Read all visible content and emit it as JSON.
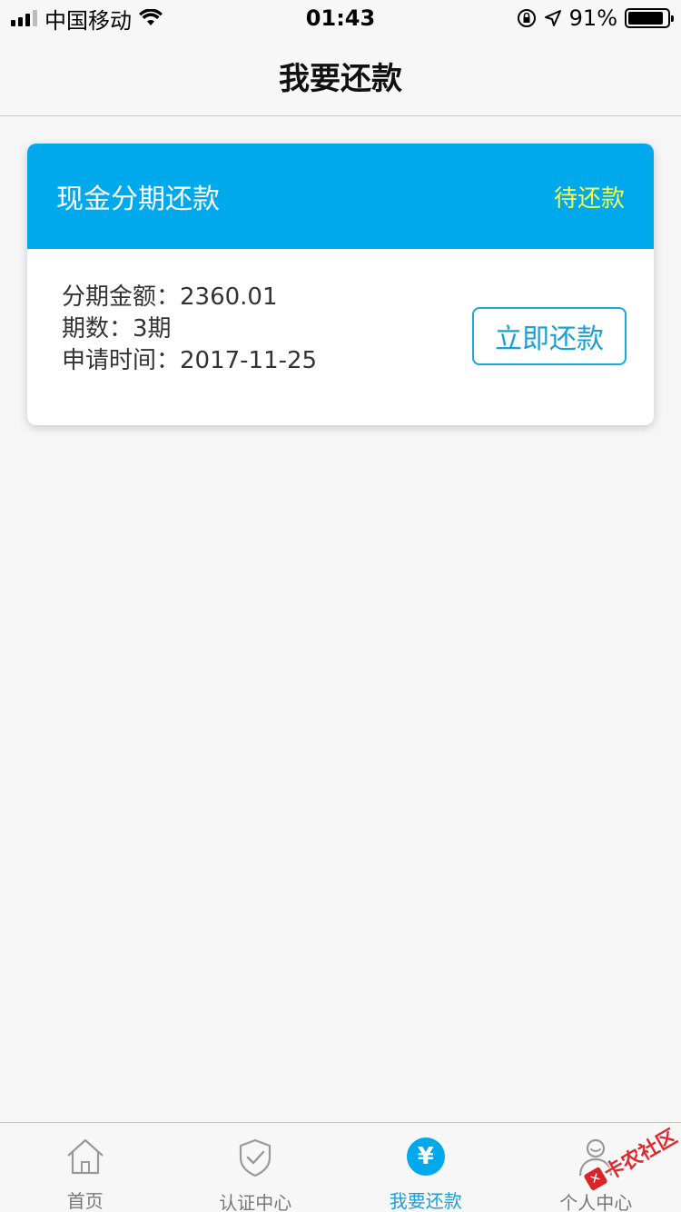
{
  "status_bar": {
    "carrier": "中国移动",
    "time": "01:43",
    "battery_percent": "91%",
    "battery_level": 0.91
  },
  "nav": {
    "title": "我要还款"
  },
  "card": {
    "title": "现金分期还款",
    "status": "待还款",
    "amount_line": "分期金额：2360.01",
    "periods_line": "期数：3期",
    "date_line": "申请时间：2017-11-25",
    "pay_button_label": "立即还款"
  },
  "tabs": [
    {
      "label": "首页",
      "icon": "home-icon"
    },
    {
      "label": "认证中心",
      "icon": "shield-check-icon"
    },
    {
      "label": "我要还款",
      "icon": "yen-icon",
      "active": true
    },
    {
      "label": "个人中心",
      "icon": "user-icon"
    }
  ],
  "watermark": {
    "text": "卡农社区"
  },
  "colors": {
    "accent": "#00a8ec",
    "status_yellow": "#f4ff4f",
    "button_border": "#1aa6de"
  }
}
